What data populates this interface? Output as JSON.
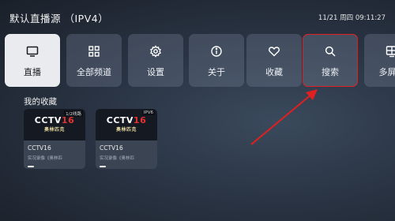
{
  "header": {
    "title": "默认直播源 （IPV4）",
    "datetime": "11/21 周四 09:11:27"
  },
  "menu": [
    {
      "label": "直播",
      "icon": "tv-icon"
    },
    {
      "label": "全部频道",
      "icon": "grid-icon"
    },
    {
      "label": "设置",
      "icon": "gear-icon"
    },
    {
      "label": "关于",
      "icon": "info-icon"
    },
    {
      "label": "收藏",
      "icon": "heart-icon"
    },
    {
      "label": "搜索",
      "icon": "search-icon"
    },
    {
      "label": "多屏同",
      "icon": "multiscreen-icon"
    }
  ],
  "favorites": {
    "heading": "我的收藏",
    "cards": [
      {
        "logo_main": "CCTV",
        "logo_num": "16",
        "logo_sub": "奥林匹克",
        "badge": "1/2线路",
        "title": "CCTV16",
        "desc": "实况录像《奥林匹",
        "progress": 0.1
      },
      {
        "logo_main": "CCTV",
        "logo_num": "16",
        "logo_sub": "奥林匹克",
        "badge": "IPV6",
        "title": "CCTV16",
        "desc": "实况录像《奥林匹",
        "progress": 0.1
      }
    ]
  },
  "colors": {
    "focus_outline": "#e02020",
    "arrow": "#e02020",
    "active_tile": "#e9ebee"
  }
}
